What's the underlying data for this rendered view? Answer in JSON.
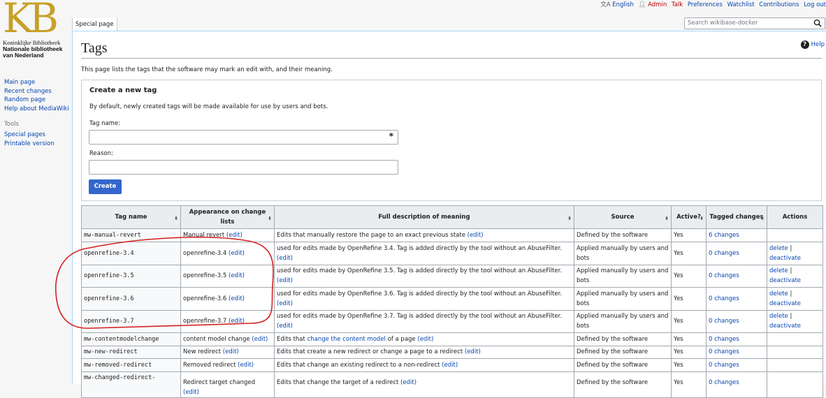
{
  "logo": {
    "mark": "KB",
    "line1": "Koninklijke Bibliotheek",
    "line2": "Nationale bibliotheek",
    "line3": "van Nederland"
  },
  "sidebar": {
    "nav": [
      "Main page",
      "Recent changes",
      "Random page",
      "Help about MediaWiki"
    ],
    "tools_label": "Tools",
    "tools": [
      "Special pages",
      "Printable version"
    ]
  },
  "personal_tools": {
    "language": "English",
    "user": "Admin",
    "talk": "Talk",
    "preferences": "Preferences",
    "watchlist": "Watchlist",
    "contributions": "Contributions",
    "logout": "Log out"
  },
  "tab": "Special page",
  "search": {
    "placeholder": "Search wikibase-docker"
  },
  "page": {
    "title": "Tags",
    "help": "Help",
    "intro": "This page lists the tags that the software may mark an edit with, and their meaning."
  },
  "form": {
    "legend": "Create a new tag",
    "description": "By default, newly created tags will be made available for use by users and bots.",
    "tag_label": "Tag name:",
    "reason_label": "Reason:",
    "create": "Create"
  },
  "table": {
    "headers": {
      "tag_name": "Tag name",
      "appearance": "Appearance on change lists",
      "description": "Full description of meaning",
      "source": "Source",
      "active": "Active?",
      "tagged": "Tagged changes",
      "actions": "Actions"
    },
    "edit": "(edit)",
    "delete": "delete",
    "deactivate": "deactivate",
    "rows": [
      {
        "name": "mw-manual-revert",
        "appearance": "Manual revert",
        "desc": "Edits that manually restore the page to an exact previous state",
        "source": "Defined by the software",
        "active": "Yes",
        "changes": "6 changes"
      },
      {
        "name": "openrefine-3.4",
        "appearance": "openrefine-3.4",
        "desc": "used for edits made by OpenRefine 3.4. Tag is added directly by the tool without an AbuseFilter.",
        "source": "Applied manually by users and bots",
        "active": "Yes",
        "changes": "0 changes"
      },
      {
        "name": "openrefine-3.5",
        "appearance": "openrefine-3.5",
        "desc": "used for edits made by OpenRefine 3.5. Tag is added directly by the tool without an AbuseFilter.",
        "source": "Applied manually by users and bots",
        "active": "Yes",
        "changes": "0 changes"
      },
      {
        "name": "openrefine-3.6",
        "appearance": "openrefine-3.6",
        "desc": "used for edits made by OpenRefine 3.6. Tag is added directly by the tool without an AbuseFilter.",
        "source": "Applied manually by users and bots",
        "active": "Yes",
        "changes": "0 changes"
      },
      {
        "name": "openrefine-3.7",
        "appearance": "openrefine-3.7",
        "desc": "used for edits made by OpenRefine 3.7. Tag is added directly by the tool without an AbuseFilter.",
        "source": "Applied manually by users and bots",
        "active": "Yes",
        "changes": "0 changes"
      },
      {
        "name": "mw-contentmodelchange",
        "appearance": "content model change",
        "desc_pre": "Edits that",
        "desc_link": "change the content model",
        "desc_post": "of a page",
        "source": "Defined by the software",
        "active": "Yes",
        "changes": "0 changes"
      },
      {
        "name": "mw-new-redirect",
        "appearance": "New redirect",
        "desc": "Edits that create a new redirect or change a page to a redirect",
        "source": "Defined by the software",
        "active": "Yes",
        "changes": "0 changes"
      },
      {
        "name": "mw-removed-redirect",
        "appearance": "Removed redirect",
        "desc": "Edits that change an existing redirect to a non-redirect",
        "source": "Defined by the software",
        "active": "Yes",
        "changes": "0 changes"
      },
      {
        "name": "mw-changed-redirect-",
        "appearance": "Redirect target changed",
        "desc": "Edits that change the target of a redirect",
        "source": "Defined by the software",
        "active": "Yes",
        "changes": "0 changes"
      }
    ]
  },
  "colors": {
    "link": "#0645ad",
    "button": "#3366cc",
    "annotation": "#d42020"
  }
}
